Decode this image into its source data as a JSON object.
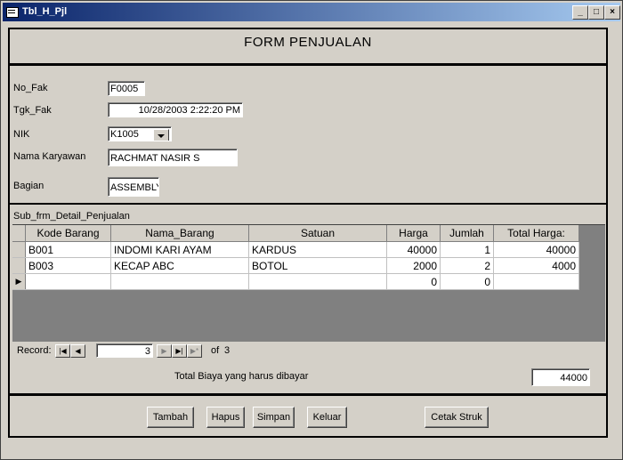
{
  "window": {
    "title": "Tbl_H_Pjl",
    "minimize": "_",
    "maximize": "□",
    "close": "×"
  },
  "form": {
    "title": "FORM PENJUALAN"
  },
  "fields": {
    "no_fak": {
      "label": "No_Fak",
      "value": "F0005"
    },
    "tgk_fak": {
      "label": "Tgk_Fak",
      "value": "10/28/2003 2:22:20 PM"
    },
    "nik": {
      "label": "NIK",
      "value": "K1005"
    },
    "nama_karyawan": {
      "label": "Nama Karyawan",
      "value": "RACHMAT NASIR S"
    },
    "bagian": {
      "label": "Bagian",
      "value": "ASSEMBLY"
    }
  },
  "subform": {
    "label": "Sub_frm_Detail_Penjualan",
    "columns": [
      "Kode Barang",
      "Nama_Barang",
      "Satuan",
      "Harga",
      "Jumlah",
      "Total Harga:"
    ],
    "rows": [
      [
        "B001",
        "INDOMI KARI AYAM",
        "KARDUS",
        "40000",
        "1",
        "40000"
      ],
      [
        "B003",
        "KECAP ABC",
        "BOTOL",
        "2000",
        "2",
        "4000"
      ],
      [
        "",
        "",
        "",
        "0",
        "0",
        ""
      ]
    ],
    "nav": {
      "label": "Record:",
      "current": "3",
      "of_label": "of",
      "total": "3"
    }
  },
  "total": {
    "label": "Total Biaya yang harus dibayar",
    "value": "44000"
  },
  "buttons": {
    "tambah": "Tambah",
    "hapus": "Hapus",
    "simpan": "Simpan",
    "keluar": "Keluar",
    "cetak": "Cetak Struk"
  }
}
